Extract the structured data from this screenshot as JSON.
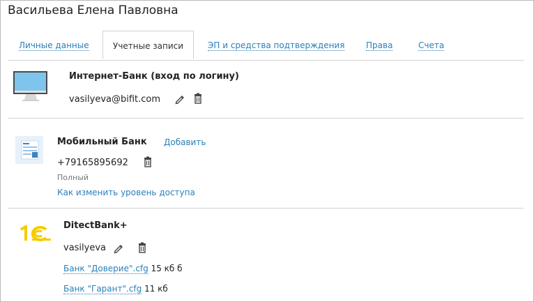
{
  "user": {
    "name": "Васильева Елена Павловна"
  },
  "tabs": [
    {
      "label": "Личные данные"
    },
    {
      "label": "Учетные записи"
    },
    {
      "label": "ЭП и средства подтверждения"
    },
    {
      "label": "Права"
    },
    {
      "label": "Счета"
    }
  ],
  "internet_bank": {
    "title": "Интернет-Банк (вход по логину)",
    "login": "vasilyeva@bifit.com"
  },
  "mobile_bank": {
    "title": "Мобильный Банк",
    "add_label": "Добавить",
    "phone": "+79165895692",
    "access_level": "Полный",
    "change_access_link": "Как изменить уровень доступа"
  },
  "ditect": {
    "title": "DitectBank+",
    "login": "vasilyeva",
    "files": [
      {
        "name": "Банк \"Доверие\".cfg",
        "size": "15 кб",
        "extra": "б"
      },
      {
        "name": "Банк \"Гарант\".cfg",
        "size": "11 кб"
      }
    ]
  },
  "colors": {
    "link": "#2a7fb8",
    "logo_1c": "#f5cc00"
  }
}
